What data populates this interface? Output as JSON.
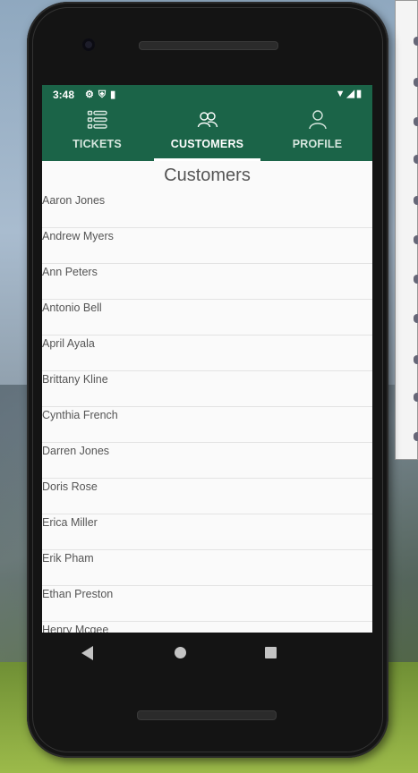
{
  "status_bar": {
    "time": "3:48",
    "left_icons": [
      "gear-icon",
      "shield-icon",
      "sd-card-icon"
    ],
    "right_icons": [
      "wifi-icon",
      "signal-icon",
      "battery-icon"
    ]
  },
  "tabs": [
    {
      "label": "TICKETS",
      "icon": "list-icon",
      "active": false
    },
    {
      "label": "CUSTOMERS",
      "icon": "people-icon",
      "active": true
    },
    {
      "label": "PROFILE",
      "icon": "person-icon",
      "active": false
    }
  ],
  "page": {
    "title": "Customers"
  },
  "customers": [
    "Aaron Jones",
    "Andrew Myers",
    "Ann Peters",
    "Antonio Bell",
    "April Ayala",
    "Brittany Kline",
    "Cynthia French",
    "Darren Jones",
    "Doris Rose",
    "Erica Miller",
    "Erik Pham",
    "Ethan Preston",
    "Henry Mcgee"
  ],
  "nav_bar": {
    "buttons": [
      "back-icon",
      "home-icon",
      "recents-icon"
    ]
  },
  "colors": {
    "brand": "#1b6448",
    "tab_indicator": "#ffffff"
  }
}
